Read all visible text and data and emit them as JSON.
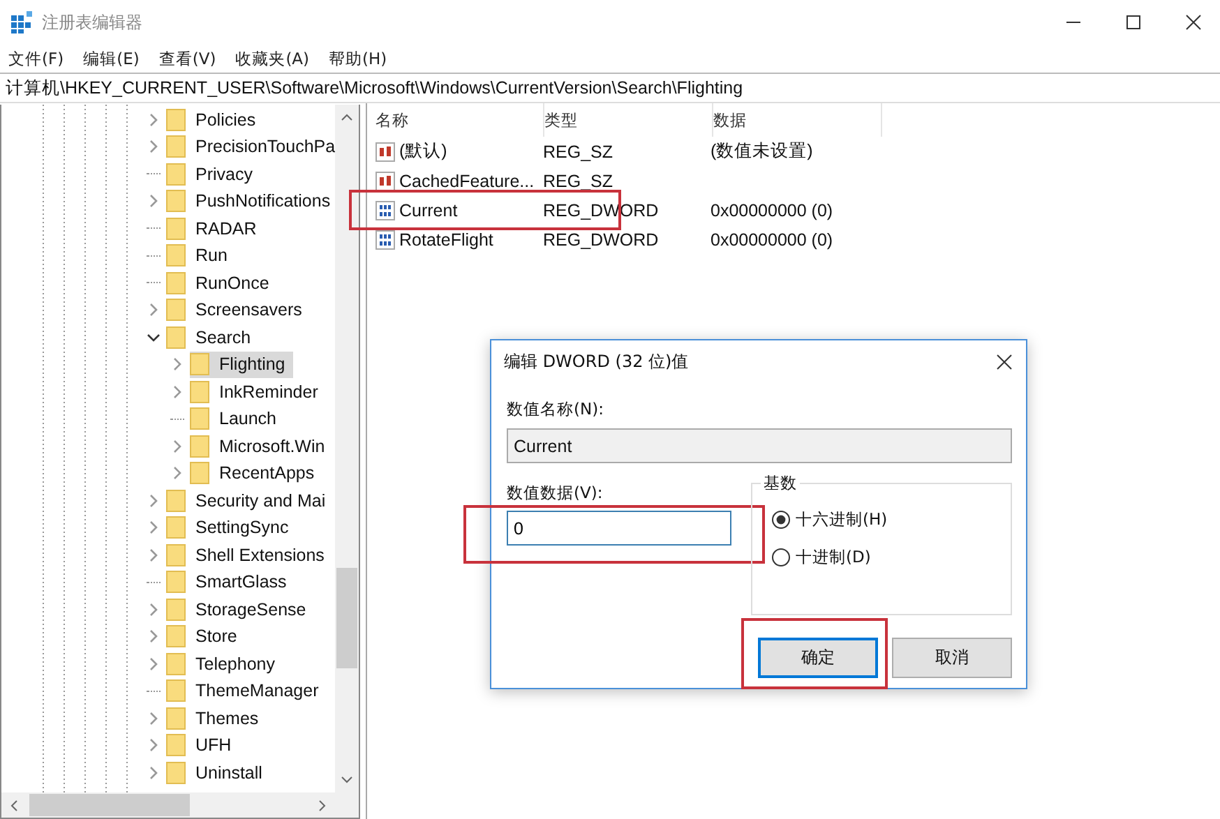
{
  "window": {
    "title": "注册表编辑器"
  },
  "menu": [
    "文件(F)",
    "编辑(E)",
    "查看(V)",
    "收藏夹(A)",
    "帮助(H)"
  ],
  "address": "计算机\\HKEY_CURRENT_USER\\Software\\Microsoft\\Windows\\CurrentVersion\\Search\\Flighting",
  "tree": {
    "items": [
      {
        "label": "Policies",
        "has_children": true,
        "expanded": false,
        "selected": false
      },
      {
        "label": "PrecisionTouchPa",
        "has_children": true,
        "expanded": false,
        "selected": false
      },
      {
        "label": "Privacy",
        "has_children": false,
        "selected": false
      },
      {
        "label": "PushNotifications",
        "has_children": true,
        "expanded": false,
        "selected": false
      },
      {
        "label": "RADAR",
        "has_children": false,
        "selected": false
      },
      {
        "label": "Run",
        "has_children": false,
        "selected": false
      },
      {
        "label": "RunOnce",
        "has_children": false,
        "selected": false
      },
      {
        "label": "Screensavers",
        "has_children": true,
        "expanded": false,
        "selected": false
      },
      {
        "label": "Search",
        "has_children": true,
        "expanded": true,
        "selected": false,
        "children": [
          {
            "label": "Flighting",
            "has_children": true,
            "expanded": false,
            "selected": true
          },
          {
            "label": "InkReminder",
            "has_children": true,
            "expanded": false,
            "selected": false
          },
          {
            "label": "Launch",
            "has_children": false,
            "selected": false
          },
          {
            "label": "Microsoft.Win",
            "has_children": true,
            "expanded": false,
            "selected": false
          },
          {
            "label": "RecentApps",
            "has_children": true,
            "expanded": false,
            "selected": false
          }
        ]
      },
      {
        "label": "Security and Mai",
        "has_children": true,
        "expanded": false,
        "selected": false
      },
      {
        "label": "SettingSync",
        "has_children": true,
        "expanded": false,
        "selected": false
      },
      {
        "label": "Shell Extensions",
        "has_children": true,
        "expanded": false,
        "selected": false
      },
      {
        "label": "SmartGlass",
        "has_children": false,
        "selected": false
      },
      {
        "label": "StorageSense",
        "has_children": true,
        "expanded": false,
        "selected": false
      },
      {
        "label": "Store",
        "has_children": true,
        "expanded": false,
        "selected": false
      },
      {
        "label": "Telephony",
        "has_children": true,
        "expanded": false,
        "selected": false
      },
      {
        "label": "ThemeManager",
        "has_children": false,
        "selected": false
      },
      {
        "label": "Themes",
        "has_children": true,
        "expanded": false,
        "selected": false
      },
      {
        "label": "UFH",
        "has_children": true,
        "expanded": false,
        "selected": false
      },
      {
        "label": "Uninstall",
        "has_children": true,
        "expanded": false,
        "selected": false
      }
    ]
  },
  "values": {
    "columns": [
      "名称",
      "类型",
      "数据"
    ],
    "rows": [
      {
        "kind": "sz",
        "name": "(默认)",
        "type": "REG_SZ",
        "data": "(数值未设置)",
        "highlighted": false
      },
      {
        "kind": "sz",
        "name": "CachedFeature...",
        "type": "REG_SZ",
        "highlighted": false
      },
      {
        "kind": "dword",
        "name": "Current",
        "type": "REG_DWORD",
        "data": "0x00000000 (0)",
        "highlighted": true
      },
      {
        "kind": "dword",
        "name": "RotateFlight",
        "type": "REG_DWORD",
        "data": "0x00000000 (0)",
        "highlighted": false
      }
    ]
  },
  "dialog": {
    "title": "编辑 DWORD (32 位)值",
    "name_label": "数值名称(N):",
    "name_value": "Current",
    "data_label": "数值数据(V):",
    "data_value": "0",
    "data_highlighted": true,
    "base_label": "基数",
    "radios": [
      {
        "label": "十六进制(H)",
        "selected": true
      },
      {
        "label": "十进制(D)",
        "selected": false
      }
    ],
    "buttons": [
      {
        "label": "确定",
        "default": true,
        "highlighted": true
      },
      {
        "label": "取消",
        "default": false,
        "highlighted": false
      }
    ]
  }
}
